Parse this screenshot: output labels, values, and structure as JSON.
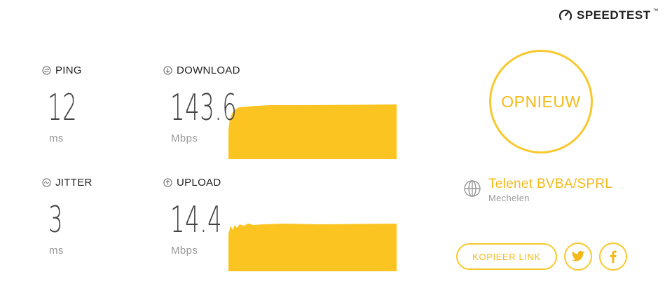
{
  "brand": {
    "name": "SPEEDTEST",
    "trademark": "™"
  },
  "colors": {
    "accent": "#f8c82e",
    "accent_text": "#f3b91a",
    "graph_fill": "#fcc421"
  },
  "metrics": {
    "ping": {
      "label": "PING",
      "value": "12",
      "unit": "ms",
      "icon": "ping-icon"
    },
    "jitter": {
      "label": "JITTER",
      "value": "3",
      "unit": "ms",
      "icon": "jitter-icon"
    },
    "download": {
      "label": "DOWNLOAD",
      "value": "143.6",
      "unit": "Mbps",
      "icon": "download-arrow-icon"
    },
    "upload": {
      "label": "UPLOAD",
      "value": "14.4",
      "unit": "Mbps",
      "icon": "upload-arrow-icon"
    }
  },
  "actions": {
    "restart_label": "OPNIEUW",
    "copy_link_label": "KOPIEER LINK"
  },
  "isp": {
    "name": "Telenet BVBA/SPRL",
    "location": "Mechelen",
    "icon": "globe-icon"
  },
  "share": {
    "twitter_icon": "twitter-icon",
    "facebook_icon": "facebook-icon"
  }
}
